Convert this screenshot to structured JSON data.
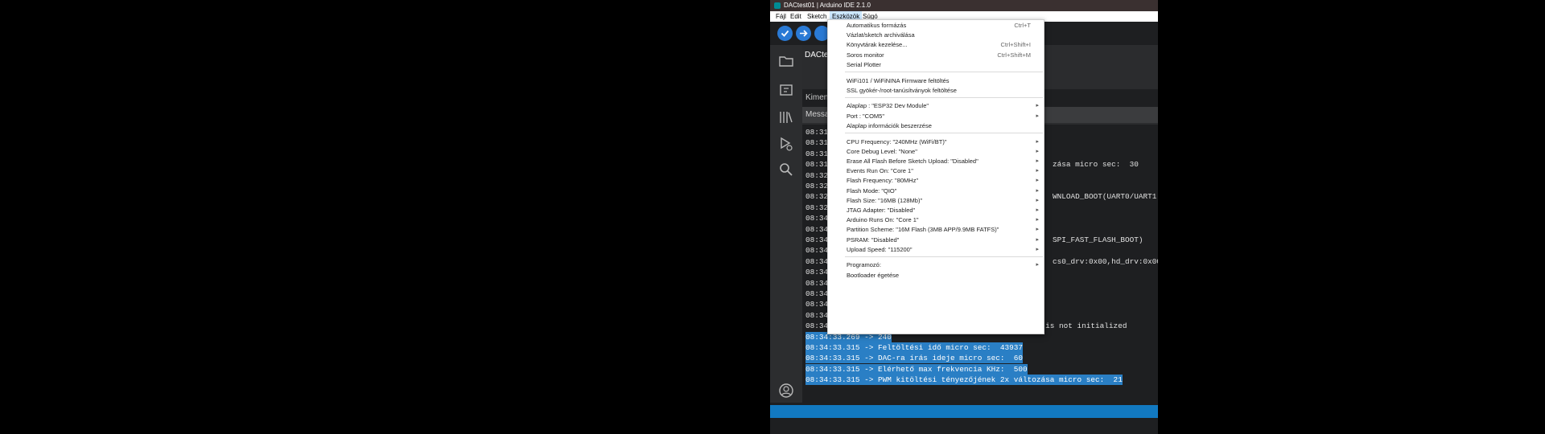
{
  "window": {
    "title": "DACtest01 | Arduino IDE 2.1.0"
  },
  "menubar": [
    {
      "label": "Fájl"
    },
    {
      "label": "Edit"
    },
    {
      "label": "Sketch"
    },
    {
      "label": "Eszközök",
      "active": true
    },
    {
      "label": "Súgó"
    }
  ],
  "editor": {
    "tab_title": "DACte"
  },
  "panel": {
    "output_tab": "Kimen",
    "message_bar": "Messa"
  },
  "console": {
    "lines": [
      {
        "time": "08:31",
        "text": ""
      },
      {
        "time": "08:31",
        "text": ""
      },
      {
        "time": "08:31",
        "text": ""
      },
      {
        "time": "08:31",
        "text": ""
      },
      {
        "time": "08:32",
        "text": ""
      },
      {
        "time": "08:32",
        "text": ""
      },
      {
        "time": "08:32",
        "text": ""
      },
      {
        "time": "08:32",
        "text": ""
      },
      {
        "time": "08:34",
        "text": ""
      },
      {
        "time": "08:34",
        "text": ""
      },
      {
        "time": "08:34",
        "text": ""
      },
      {
        "time": "08:34",
        "text": ""
      },
      {
        "time": "08:34",
        "text": ""
      },
      {
        "time": "08:34",
        "text": ""
      },
      {
        "time": "08:34",
        "text": ""
      },
      {
        "time": "08:34",
        "text": ""
      },
      {
        "time": "08:34",
        "text": ""
      },
      {
        "time": "08:34",
        "text": ""
      },
      {
        "time": "08:34:33.269",
        "text": "08:34:33.269 -> E (3) ledc: ledc_get_duty(739): LEDC is not initialized"
      },
      {
        "time": "08:34:33.269",
        "text": "08:34:33.269 -> 240",
        "selected": true
      },
      {
        "time": "08:34:33.315",
        "text": "08:34:33.315 -> Feltöltési idő micro sec:  43937",
        "selected": true
      },
      {
        "time": "08:34:33.315",
        "text": "08:34:33.315 -> DAC-ra írás ideje micro sec:  60",
        "selected": true
      },
      {
        "time": "08:34:33.315",
        "text": "08:34:33.315 -> Elérhető max frekvencia KHz:  500",
        "selected": true
      },
      {
        "time": "08:34:33.315",
        "text": "08:34:33.315 -> PWM kitöltési tényezőjének 2x változása micro sec:  21",
        "selected": true
      }
    ],
    "right_fragments": [
      {
        "row": 3,
        "text": "zása micro sec:  30"
      },
      {
        "row": 6,
        "text": "WNLOAD_BOOT(UART0/UART1"
      },
      {
        "row": 10,
        "text": "SPI_FAST_FLASH_BOOT)"
      },
      {
        "row": 12,
        "text": "cs0_drv:0x00,hd_drv:0x00"
      }
    ]
  },
  "menu": {
    "items": [
      {
        "label": "Automatikus formázás",
        "shortcut": "Ctrl+T"
      },
      {
        "label": "Vázlat/sketch archiválása"
      },
      {
        "label": "Könyvtárak kezelése...",
        "shortcut": "Ctrl+Shift+I"
      },
      {
        "label": "Soros monitor",
        "shortcut": "Ctrl+Shift+M"
      },
      {
        "label": "Serial Plotter"
      },
      {
        "separator": true
      },
      {
        "label": "WiFi101 / WiFiNINA Firmware feltöltés"
      },
      {
        "label": "SSL gyökér-/root-tanúsítványok feltöltése"
      },
      {
        "separator": true
      },
      {
        "label": "Alaplap : \"ESP32 Dev Module\"",
        "submenu": true
      },
      {
        "label": "Port : \"COM5\"",
        "submenu": true
      },
      {
        "label": "Alaplap információk beszerzése"
      },
      {
        "separator": true
      },
      {
        "label": "CPU Frequency: \"240MHz (WiFi/BT)\"",
        "submenu": true
      },
      {
        "label": "Core Debug Level: \"None\"",
        "submenu": true
      },
      {
        "label": "Erase All Flash Before Sketch Upload: \"Disabled\"",
        "submenu": true
      },
      {
        "label": "Events Run On: \"Core 1\"",
        "submenu": true
      },
      {
        "label": "Flash Frequency: \"80MHz\"",
        "submenu": true
      },
      {
        "label": "Flash Mode: \"QIO\"",
        "submenu": true
      },
      {
        "label": "Flash Size: \"16MB (128Mb)\"",
        "submenu": true
      },
      {
        "label": "JTAG Adapter: \"Disabled\"",
        "submenu": true
      },
      {
        "label": "Arduino Runs On: \"Core 1\"",
        "submenu": true
      },
      {
        "label": "Partition Scheme: \"16M Flash (3MB APP/9.9MB FATFS)\"",
        "submenu": true
      },
      {
        "label": "PSRAM: \"Disabled\"",
        "submenu": true
      },
      {
        "label": "Upload Speed: \"115200\"",
        "submenu": true
      },
      {
        "separator": true
      },
      {
        "label": "Programozó:",
        "submenu": true
      },
      {
        "label": "Bootloader égetése"
      }
    ]
  }
}
